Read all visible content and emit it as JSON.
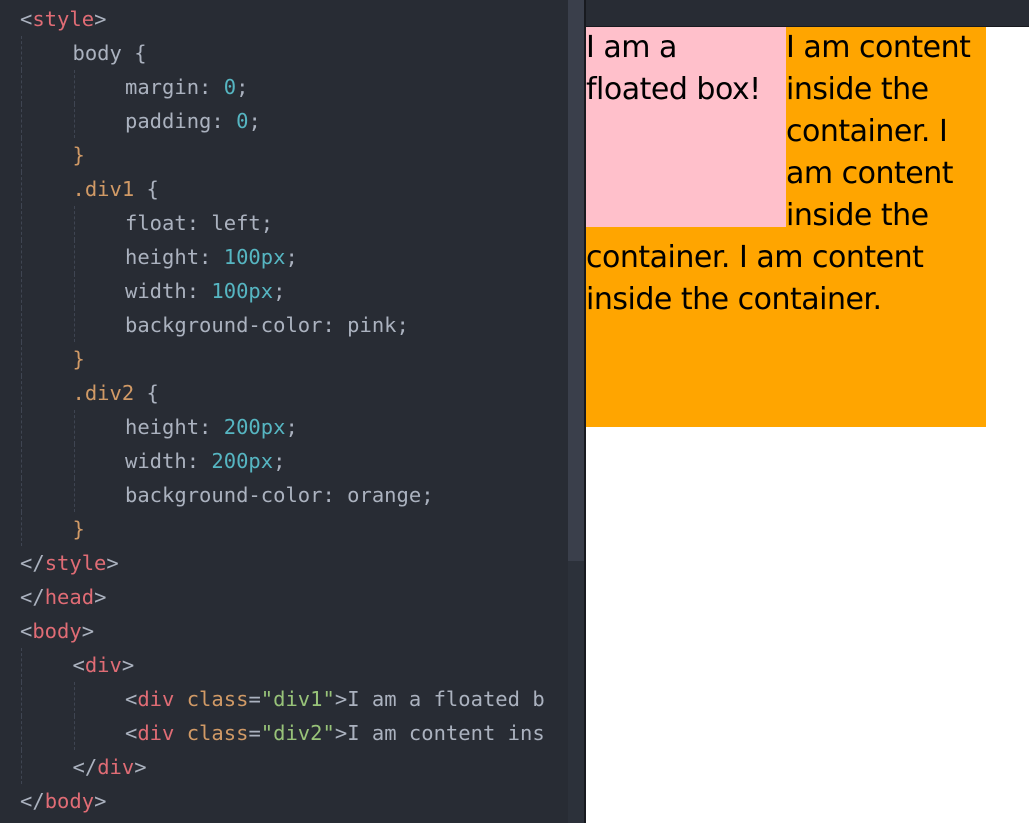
{
  "editor": {
    "lines": [
      {
        "indent": 0,
        "tokens": [
          [
            "p",
            "<"
          ],
          [
            "tag",
            "style"
          ],
          [
            "p",
            ">"
          ]
        ]
      },
      {
        "indent": 1,
        "tokens": [
          [
            "prop",
            "body {"
          ]
        ]
      },
      {
        "indent": 2,
        "tokens": [
          [
            "prop",
            "margin: "
          ],
          [
            "num",
            "0"
          ],
          [
            "p",
            ";"
          ]
        ]
      },
      {
        "indent": 2,
        "tokens": [
          [
            "prop",
            "padding: "
          ],
          [
            "num",
            "0"
          ],
          [
            "p",
            ";"
          ]
        ]
      },
      {
        "indent": 1,
        "tokens": [
          [
            "sel",
            "}"
          ]
        ]
      },
      {
        "indent": 1,
        "tokens": [
          [
            "sel",
            ".div1"
          ],
          [
            "p",
            " {"
          ]
        ]
      },
      {
        "indent": 2,
        "tokens": [
          [
            "prop",
            "float: left;"
          ]
        ]
      },
      {
        "indent": 2,
        "tokens": [
          [
            "prop",
            "height: "
          ],
          [
            "num",
            "100px"
          ],
          [
            "p",
            ";"
          ]
        ]
      },
      {
        "indent": 2,
        "tokens": [
          [
            "prop",
            "width: "
          ],
          [
            "num",
            "100px"
          ],
          [
            "p",
            ";"
          ]
        ]
      },
      {
        "indent": 2,
        "tokens": [
          [
            "prop",
            "background-color: pink;"
          ]
        ]
      },
      {
        "indent": 1,
        "tokens": [
          [
            "sel",
            "}"
          ]
        ]
      },
      {
        "indent": 1,
        "tokens": [
          [
            "sel",
            ".div2"
          ],
          [
            "p",
            " {"
          ]
        ]
      },
      {
        "indent": 2,
        "tokens": [
          [
            "prop",
            "height: "
          ],
          [
            "num",
            "200px"
          ],
          [
            "p",
            ";"
          ]
        ]
      },
      {
        "indent": 2,
        "tokens": [
          [
            "prop",
            "width: "
          ],
          [
            "num",
            "200px"
          ],
          [
            "p",
            ";"
          ]
        ]
      },
      {
        "indent": 2,
        "tokens": [
          [
            "prop",
            "background-color: orange;"
          ]
        ]
      },
      {
        "indent": 1,
        "tokens": [
          [
            "sel",
            "}"
          ]
        ]
      },
      {
        "indent": 0,
        "tokens": [
          [
            "p",
            "</"
          ],
          [
            "tag",
            "style"
          ],
          [
            "p",
            ">"
          ]
        ]
      },
      {
        "indent": 0,
        "tokens": [
          [
            "p",
            "</"
          ],
          [
            "tag",
            "head"
          ],
          [
            "p",
            ">"
          ]
        ]
      },
      {
        "indent": 0,
        "tokens": [
          [
            "p",
            "<"
          ],
          [
            "tag",
            "body"
          ],
          [
            "p",
            ">"
          ]
        ]
      },
      {
        "indent": 1,
        "tokens": [
          [
            "p",
            "<"
          ],
          [
            "tag",
            "div"
          ],
          [
            "p",
            ">"
          ]
        ]
      },
      {
        "indent": 2,
        "tokens": [
          [
            "p",
            "<"
          ],
          [
            "tag",
            "div"
          ],
          [
            "p",
            " "
          ],
          [
            "attr",
            "class"
          ],
          [
            "p",
            "="
          ],
          [
            "str",
            "\"div1\""
          ],
          [
            "p",
            ">"
          ],
          [
            "txt",
            "I am a floated b"
          ]
        ]
      },
      {
        "indent": 2,
        "tokens": [
          [
            "p",
            "<"
          ],
          [
            "tag",
            "div"
          ],
          [
            "p",
            " "
          ],
          [
            "attr",
            "class"
          ],
          [
            "p",
            "="
          ],
          [
            "str",
            "\"div2\""
          ],
          [
            "p",
            ">"
          ],
          [
            "txt",
            "I am content ins"
          ]
        ]
      },
      {
        "indent": 1,
        "tokens": [
          [
            "p",
            "</"
          ],
          [
            "tag",
            "div"
          ],
          [
            "p",
            ">"
          ]
        ]
      },
      {
        "indent": 0,
        "tokens": [
          [
            "p",
            "</"
          ],
          [
            "tag",
            "body"
          ],
          [
            "p",
            ">"
          ]
        ]
      }
    ]
  },
  "preview": {
    "floated_text": "I am a floated box!",
    "content_text": "I am content inside the container. I am content inside the container. I am content inside the container.",
    "colors": {
      "floated": "pink",
      "container": "orange"
    }
  }
}
